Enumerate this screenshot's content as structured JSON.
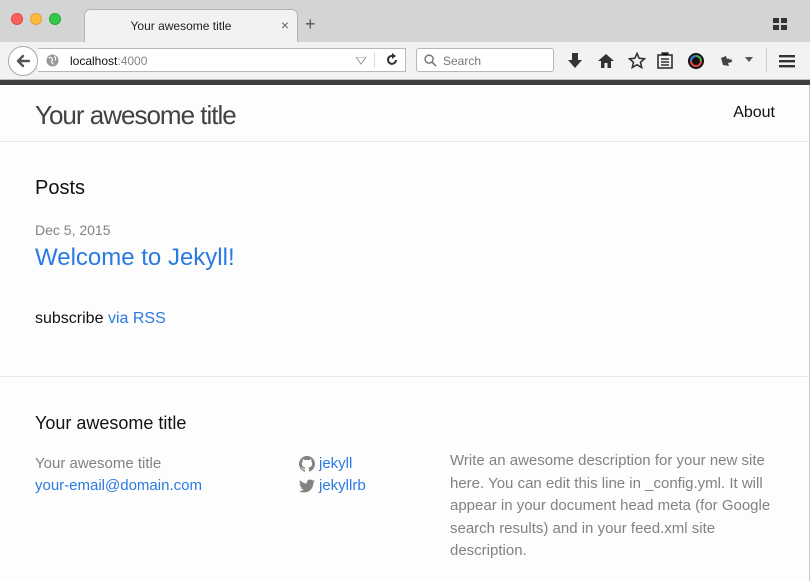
{
  "browser": {
    "tab_title": "Your awesome title",
    "tab_close": "×",
    "new_tab": "+",
    "url_host": "localhost",
    "url_port": ":4000",
    "search_placeholder": "Search"
  },
  "site": {
    "title": "Your awesome title",
    "nav": {
      "about": "About"
    }
  },
  "main": {
    "heading": "Posts",
    "posts": [
      {
        "date": "Dec 5, 2015",
        "title": "Welcome to Jekyll!"
      }
    ],
    "subscribe_text": "subscribe",
    "subscribe_link": "via RSS"
  },
  "footer": {
    "heading": "Your awesome title",
    "name": "Your awesome title",
    "email": "your-email@domain.com",
    "github": "jekyll",
    "twitter": "jekyllrb",
    "description": "Write an awesome description for your new site here. You can edit this line in _config.yml. It will appear in your document head meta (for Google search results) and in your feed.xml site description."
  },
  "colors": {
    "link": "#2a7ae2",
    "muted": "#828282",
    "text": "#111111"
  }
}
